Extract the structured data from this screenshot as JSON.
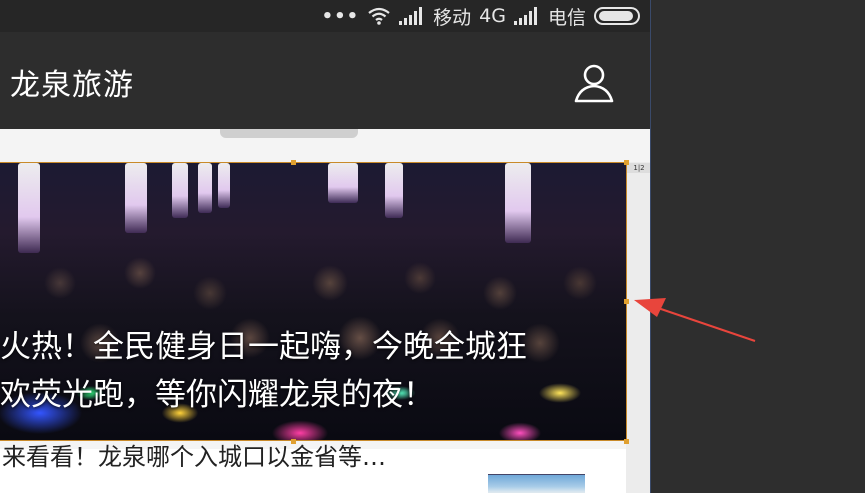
{
  "status_bar": {
    "dots": "•••",
    "carrier1": "移动",
    "network": "4G",
    "carrier2": "电信",
    "icons": [
      "wifi-icon",
      "signal-icon",
      "signal-icon",
      "battery-icon"
    ]
  },
  "app_bar": {
    "title": "龙泉旅游",
    "user_icon": "user-icon"
  },
  "banner": {
    "caption_line1": "火热！全民健身日一起嗨，今晚全城狂",
    "caption_line2": "欢荧光跑，等你闪耀龙泉的夜！"
  },
  "size_tag": "1|2",
  "list_item": {
    "title": "来看看！龙泉哪个入城口以金省等…"
  },
  "colors": {
    "app_bar_bg": "#2d2d2d",
    "status_bar_bg": "#262626",
    "selection_frame": "#c98a2a",
    "arrow": "#e8453c",
    "editor_bg": "#2e2e2e"
  }
}
